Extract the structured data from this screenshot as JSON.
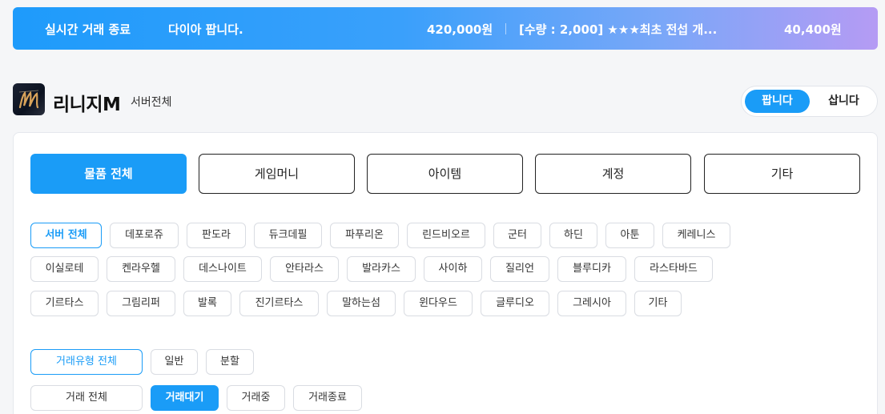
{
  "ticker": {
    "label": "실시간 거래 종료",
    "item1_title": "다이아 팝니다.",
    "item1_price": "420,000원",
    "item2_title": "[수량 : 2,000] ★★★최초 전섭 개...",
    "item2_price": "40,400원"
  },
  "game": {
    "name": "리니지M",
    "scope": "서버전체"
  },
  "trade_toggle": {
    "sell": "팝니다",
    "buy": "삽니다"
  },
  "categories": [
    "물품 전체",
    "게임머니",
    "아이템",
    "계정",
    "기타"
  ],
  "servers": [
    [
      "서버 전체",
      "데포로쥬",
      "판도라",
      "듀크데필",
      "파푸리온",
      "린드비오르",
      "군터",
      "하딘",
      "아툰",
      "케레니스"
    ],
    [
      "이실로테",
      "켄라우헬",
      "데스나이트",
      "안타라스",
      "발라카스",
      "사이하",
      "질리언",
      "블루디카",
      "라스타바드"
    ],
    [
      "기르타스",
      "그림리퍼",
      "발록",
      "진기르타스",
      "말하는섬",
      "윈다우드",
      "글루디오",
      "그레시아",
      "기타"
    ]
  ],
  "trade_types": [
    "거래유형 전체",
    "일반",
    "분할"
  ],
  "trade_status": [
    "거래 전체",
    "거래대기",
    "거래중",
    "거래종료"
  ],
  "colors": {
    "accent": "#1a9cf7",
    "ticker_start": "#1e9bfb",
    "ticker_end": "#b59bf4"
  }
}
